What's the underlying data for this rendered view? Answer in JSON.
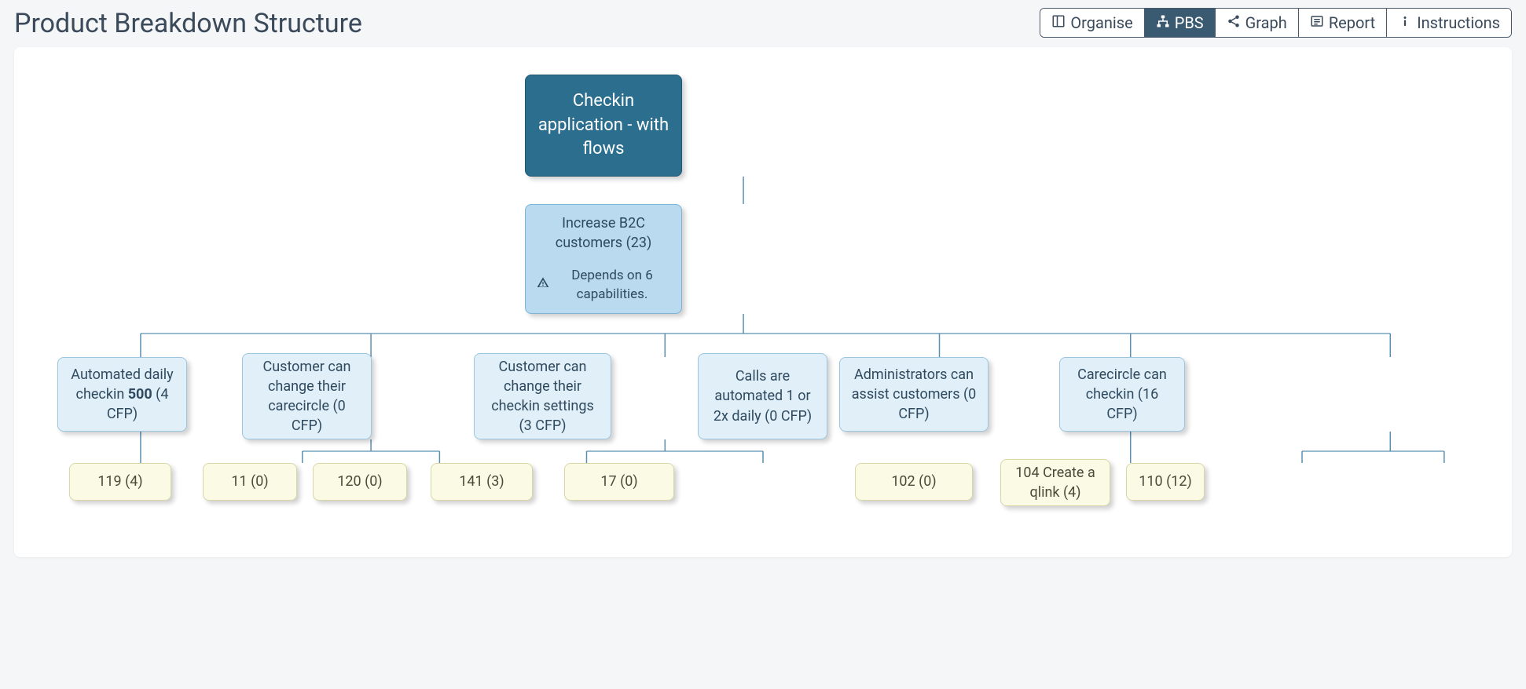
{
  "page": {
    "title": "Product Breakdown Structure"
  },
  "tabs": {
    "organise": "Organise",
    "pbs": "PBS",
    "graph": "Graph",
    "report": "Report",
    "instructions": "Instructions",
    "active": "pbs"
  },
  "root": {
    "label": "Checkin application - with flows"
  },
  "goal": {
    "label": "Increase B2C customers (23)",
    "warning": "Depends on 6 capabilities."
  },
  "caps": [
    {
      "prefix": "Automated daily checkin ",
      "bold": "500",
      "suffix": "  (4 CFP)"
    },
    {
      "label": "Customer can change their carecircle (0 CFP)"
    },
    {
      "label": "Customer can change their checkin settings (3 CFP)"
    },
    {
      "label": "Calls are automated 1 or 2x daily (0 CFP)"
    },
    {
      "label": "Administrators can assist customers (0 CFP)"
    },
    {
      "label": "Carecircle can checkin (16 CFP)"
    }
  ],
  "leaves": {
    "l119": "119 (4)",
    "l11": "11 (0)",
    "l120": "120 (0)",
    "l141": "141 (3)",
    "l17": "17 (0)",
    "l102": "102 (0)",
    "l104": "104 Create a qlink (4)",
    "l110": "110 (12)"
  }
}
